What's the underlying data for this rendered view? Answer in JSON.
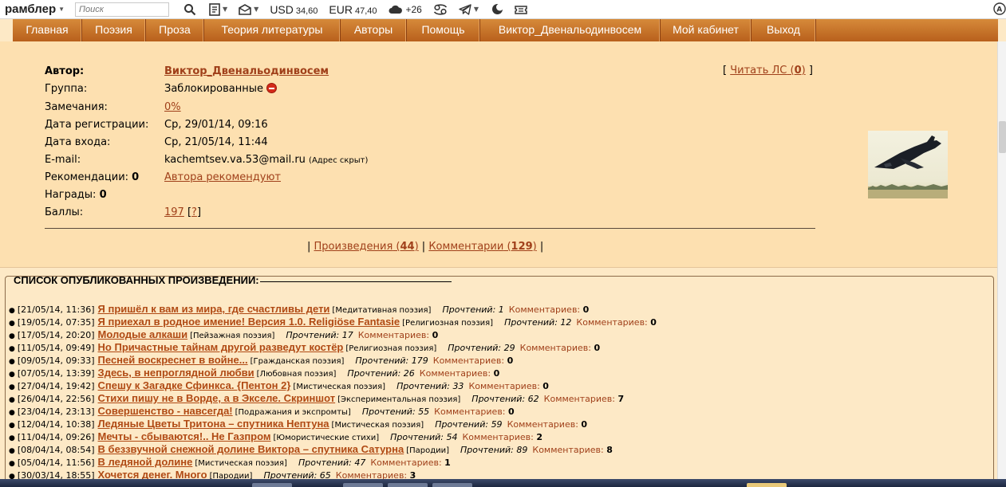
{
  "toolbar": {
    "brand": "рамблер",
    "search_placeholder": "Поиск",
    "usd_label": "USD",
    "usd_value": "34,60",
    "eur_label": "EUR",
    "eur_value": "47,40",
    "temperature": "+26",
    "icons": [
      "search-icon",
      "notebook-icon",
      "mail-icon",
      "cloud-icon",
      "cancer-sign-icon",
      "telegram-icon",
      "moon-icon",
      "ticket-icon",
      "translate-icon"
    ]
  },
  "nav": {
    "items": [
      "Главная",
      "Поэзия",
      "Проза",
      "Теория литературы",
      "Авторы",
      "Помощь",
      "Виктор_Двенальодинвосем",
      "Мой кабинет",
      "Выход"
    ]
  },
  "profile": {
    "author_label": "Автор:",
    "author_name": "Виктор_Двенальодинвосем",
    "group_label": "Группа:",
    "group_value": "Заблокированные",
    "remarks_label": "Замечания:",
    "remarks_value": "0%",
    "reg_label": "Дата регистрации:",
    "reg_value": "Ср, 29/01/14, 09:16",
    "login_label": "Дата входа:",
    "login_value": "Ср, 21/05/14, 11:44",
    "email_label": "E-mail:",
    "email_value": "kachemtsev.va.53@mail.ru",
    "email_note": "(Адрес скрыт)",
    "rec_label": "Рекомендации:",
    "rec_count": "0",
    "rec_link": "Автора рекомендуют",
    "awards_label": "Награды:",
    "awards_count": "0",
    "points_label": "Баллы:",
    "points_value": "197",
    "points_help": "?",
    "read_ls_open": "[",
    "read_ls_label": "Читать ЛС",
    "read_ls_count": "0",
    "read_ls_close": "]",
    "tab_works_label": "Произведения",
    "tab_works_count": "44",
    "tab_comments_label": "Комментарии",
    "tab_comments_count": "129"
  },
  "works": {
    "heading": "СПИСОК ОПУБЛИКОВАННЫХ ПРОИЗВЕДЕНИЙ:",
    "reads_label": "Прочтений:",
    "comments_label": "Комментариев:",
    "items": [
      {
        "date": "[21/05/14, 11:36]",
        "title": "Я пришёл к вам из мира, где счастливы дети",
        "category": "[Медитативная поэзия]",
        "reads": "1",
        "comments": "0"
      },
      {
        "date": "[19/05/14, 07:35]",
        "title": "Я приехал в родное имение! Версия 1.0. Religiöse Fantasie",
        "category": "[Религиозная поэзия]",
        "reads": "12",
        "comments": "0"
      },
      {
        "date": "[17/05/14, 20:20]",
        "title": "Молодые алкаши",
        "category": "[Пейзажная поэзия]",
        "reads": "17",
        "comments": "0"
      },
      {
        "date": "[11/05/14, 09:49]",
        "title": "Но Причастные тайнам другой разведут костёр",
        "category": "[Религиозная поэзия]",
        "reads": "29",
        "comments": "0"
      },
      {
        "date": "[09/05/14, 09:33]",
        "title": "Песней воскреснет в войне...",
        "category": "[Гражданская поэзия]",
        "reads": "179",
        "comments": "0"
      },
      {
        "date": "[07/05/14, 13:39]",
        "title": "Здесь, в непроглядной любви",
        "category": "[Любовная поэзия]",
        "reads": "26",
        "comments": "0"
      },
      {
        "date": "[27/04/14, 19:42]",
        "title": "Спешу к Загадке Сфинкса. {Пентон 2}",
        "category": "[Мистическая поэзия]",
        "reads": "33",
        "comments": "0"
      },
      {
        "date": "[26/04/14, 22:56]",
        "title": "Стихи пишу не в Ворде, а в Экселе. Скриншот",
        "category": "[Экспериментальная поэзия]",
        "reads": "62",
        "comments": "7"
      },
      {
        "date": "[23/04/14, 23:13]",
        "title": "Совершенство - навсегда!",
        "category": "[Подражания и экспромты]",
        "reads": "55",
        "comments": "0"
      },
      {
        "date": "[12/04/14, 10:38]",
        "title": "Ледяные Цветы Тритона – спутника Нептуна",
        "category": "[Мистическая поэзия]",
        "reads": "59",
        "comments": "0"
      },
      {
        "date": "[11/04/14, 09:26]",
        "title": "Мечты - сбываются!.. Не Газпром",
        "category": "[Юмористические стихи]",
        "reads": "54",
        "comments": "2"
      },
      {
        "date": "[08/04/14, 08:54]",
        "title": "В беззвучной снежной долине Виктора – спутника Сатурна",
        "category": "[Пародии]",
        "reads": "89",
        "comments": "8"
      },
      {
        "date": "[05/04/14, 11:56]",
        "title": "В ледяной долине",
        "category": "[Мистическая поэзия]",
        "reads": "47",
        "comments": "1"
      },
      {
        "date": "[30/03/14, 18:55]",
        "title": "Хочется денег. Много",
        "category": "[Пародии]",
        "reads": "65",
        "comments": "3"
      }
    ]
  }
}
